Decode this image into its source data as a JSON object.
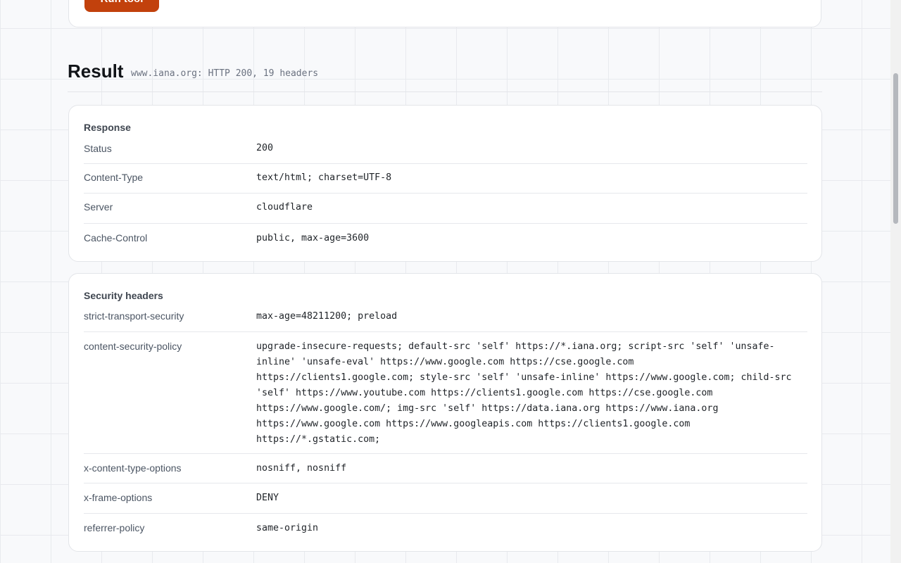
{
  "tool": {
    "run_label": "Run tool"
  },
  "result": {
    "title": "Result",
    "summary": "www.iana.org: HTTP 200, 19 headers"
  },
  "response": {
    "title": "Response",
    "rows": [
      {
        "key": "Status",
        "value": "200"
      },
      {
        "key": "Content-Type",
        "value": "text/html; charset=UTF-8"
      },
      {
        "key": "Server",
        "value": "cloudflare"
      },
      {
        "key": "Cache-Control",
        "value": "public, max-age=3600"
      }
    ]
  },
  "security": {
    "title": "Security headers",
    "rows": [
      {
        "key": "strict-transport-security",
        "value": "max-age=48211200; preload"
      },
      {
        "key": "content-security-policy",
        "value": "upgrade-insecure-requests; default-src 'self' https://*.iana.org; script-src 'self' 'unsafe-\ninline' 'unsafe-eval' https://www.google.com https://cse.google.com\nhttps://clients1.google.com; style-src 'self' 'unsafe-inline' https://www.google.com; child-src\n'self' https://www.youtube.com https://clients1.google.com https://cse.google.com\nhttps://www.google.com/; img-src 'self' https://data.iana.org https://www.iana.org\nhttps://www.google.com https://www.googleapis.com https://clients1.google.com\nhttps://*.gstatic.com;"
      },
      {
        "key": "x-content-type-options",
        "value": "nosniff, nosniff"
      },
      {
        "key": "x-frame-options",
        "value": "DENY"
      },
      {
        "key": "referrer-policy",
        "value": "same-origin"
      }
    ]
  }
}
